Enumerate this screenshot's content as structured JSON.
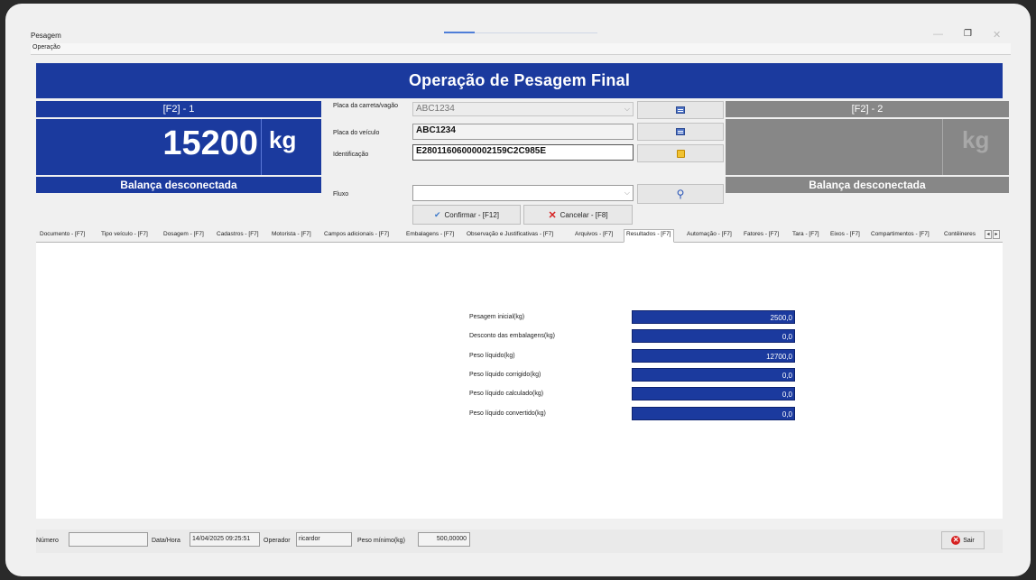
{
  "window": {
    "title": "Pesagem",
    "menu": [
      "Operação"
    ],
    "maximize_label": "❐",
    "minimize_label": "—",
    "close_label": "✕"
  },
  "header": {
    "title": "Operação de Pesagem Final"
  },
  "scale1": {
    "label": "[F2] - 1",
    "weight": "15200",
    "unit": "kg",
    "status": "Balança desconectada"
  },
  "scale2": {
    "label": "[F2] - 2",
    "weight": "",
    "unit": "kg",
    "status": "Balança desconectada"
  },
  "form": {
    "trailer_plate_label": "Placa da carreta/vagão",
    "trailer_plate_value": "ABC1234",
    "vehicle_plate_label": "Placa do veículo",
    "vehicle_plate_value": "ABC1234",
    "identification_label": "Identificação",
    "identification_value": "E28011606000002159C2C985E",
    "flow_label": "Fluxo",
    "flow_value": ""
  },
  "actions": {
    "confirm_label": "Confirmar - [F12]",
    "cancel_label": "Cancelar - [F8]"
  },
  "tabs": [
    "Documento - [F7]",
    "Tipo veículo - [F7]",
    "Dosagem - [F7]",
    "Cadastros - [F7]",
    "Motorista - [F7]",
    "Campos adicionais - [F7]",
    "Embalagens - [F7]",
    "Observação e Justificativas - [F7]",
    "Arquivos - [F7]",
    "Resultados - [F7]",
    "Automação - [F7]",
    "Fatores - [F7]",
    "Tara - [F7]",
    "Eixos - [F7]",
    "Compartimentos - [F7]",
    "Contêineres"
  ],
  "active_tab": "Resultados - [F7]",
  "results": [
    {
      "label": "Pesagem inicial(kg)",
      "value": "2500,0"
    },
    {
      "label": "Desconto das embalagens(kg)",
      "value": "0,0"
    },
    {
      "label": "Peso líquido(kg)",
      "value": "12700,0"
    },
    {
      "label": "Peso líquido corrigido(kg)",
      "value": "0,0"
    },
    {
      "label": "Peso líquido calculado(kg)",
      "value": "0,0"
    },
    {
      "label": "Peso líquido convertido(kg)",
      "value": "0,0"
    }
  ],
  "statusbar": {
    "number_label": "Número",
    "number_value": "",
    "datetime_label": "Data/Hora",
    "datetime_value": "14/04/2025 09:25:51",
    "operator_label": "Operador",
    "operator_value": "ricardor",
    "min_weight_label": "Peso mínimo(kg)",
    "min_weight_value": "500,00000",
    "exit_label": "Sair"
  }
}
